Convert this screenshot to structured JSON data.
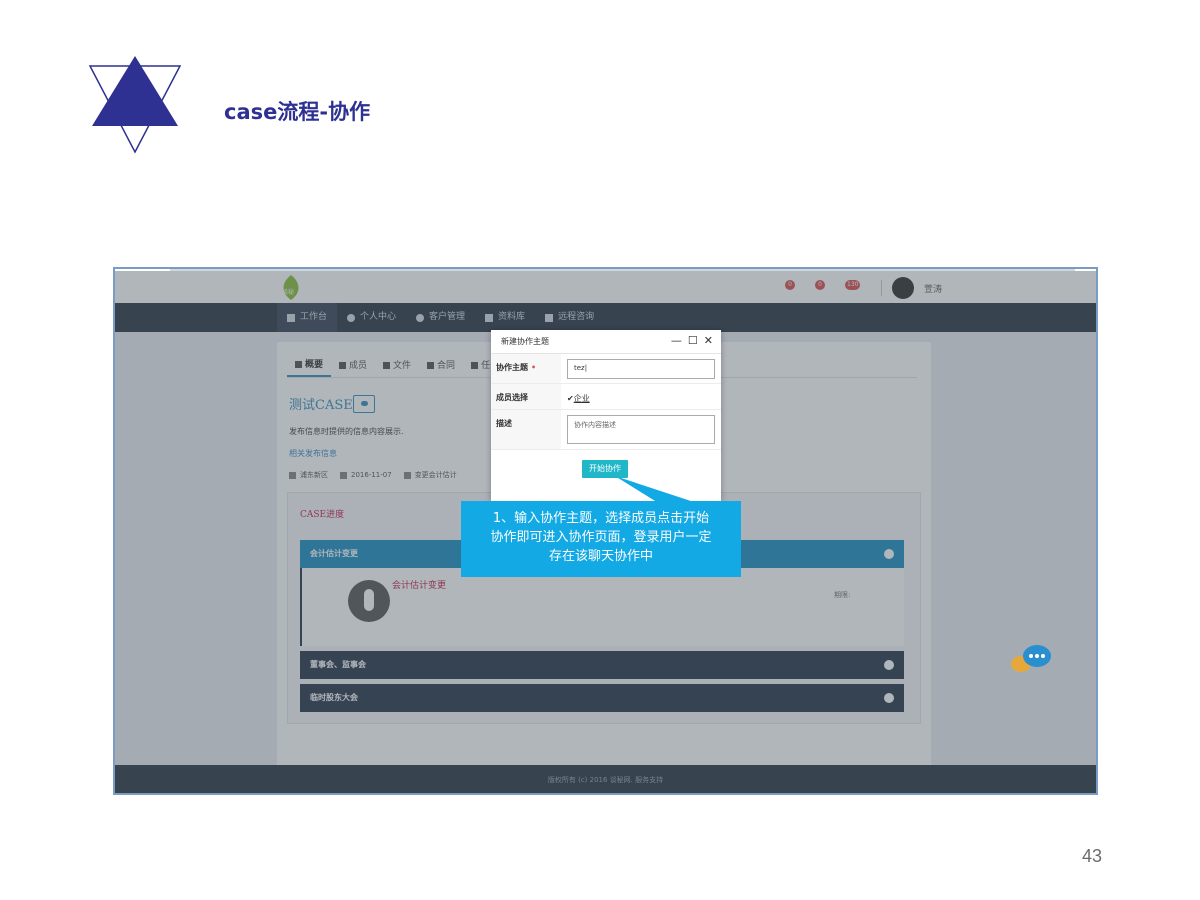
{
  "slide": {
    "title": "case流程-协作",
    "page_number": "43",
    "colors": {
      "title": "#2e3192",
      "callout": "#13a9e4"
    },
    "logo_icon": "triangle-star-logo-icon"
  },
  "app": {
    "header": {
      "logo_icon": "leaf-logo-icon",
      "badges": [
        "0",
        "0",
        "130"
      ],
      "username": "萱涛"
    },
    "nav": [
      {
        "label": "工作台",
        "icon": "dashboard-icon",
        "active": true
      },
      {
        "label": "个人中心",
        "icon": "user-icon"
      },
      {
        "label": "客户管理",
        "icon": "chat-icon"
      },
      {
        "label": "资料库",
        "icon": "database-icon"
      },
      {
        "label": "远程咨询",
        "icon": "consult-icon"
      }
    ],
    "tabs": [
      "概要",
      "成员",
      "文件",
      "合同",
      "任"
    ],
    "case": {
      "title": "测试CASE",
      "description": "发布信息时提供的信息内容展示.",
      "related_link": "相关发布信息",
      "location": "浦东新区",
      "date": "2016-11-07",
      "category": "变更会计估计"
    },
    "progress": {
      "title": "CASE进度",
      "stages": [
        "会计估计变更",
        "董事会、监事会",
        "临时股东大会"
      ],
      "detail_name": "会计估计变更",
      "detail_period": "期限:"
    },
    "footer": "版权所有 (c) 2016 谈秘网. 服务支持"
  },
  "modal": {
    "title": "新建协作主题",
    "controls": [
      "—",
      "☐",
      "✕"
    ],
    "topic_label": "协作主题",
    "topic_value": "tez|",
    "members_label": "成员选择",
    "member_option": "企业",
    "desc_label": "描述",
    "desc_placeholder": "协作内容描述",
    "start_button": "开始协作"
  },
  "callout": {
    "text_line1": "1、输入协作主题，选择成员点击开始",
    "text_line2": "协作即可进入协作页面，登录用户一定",
    "text_line3": "存在该聊天协作中"
  }
}
